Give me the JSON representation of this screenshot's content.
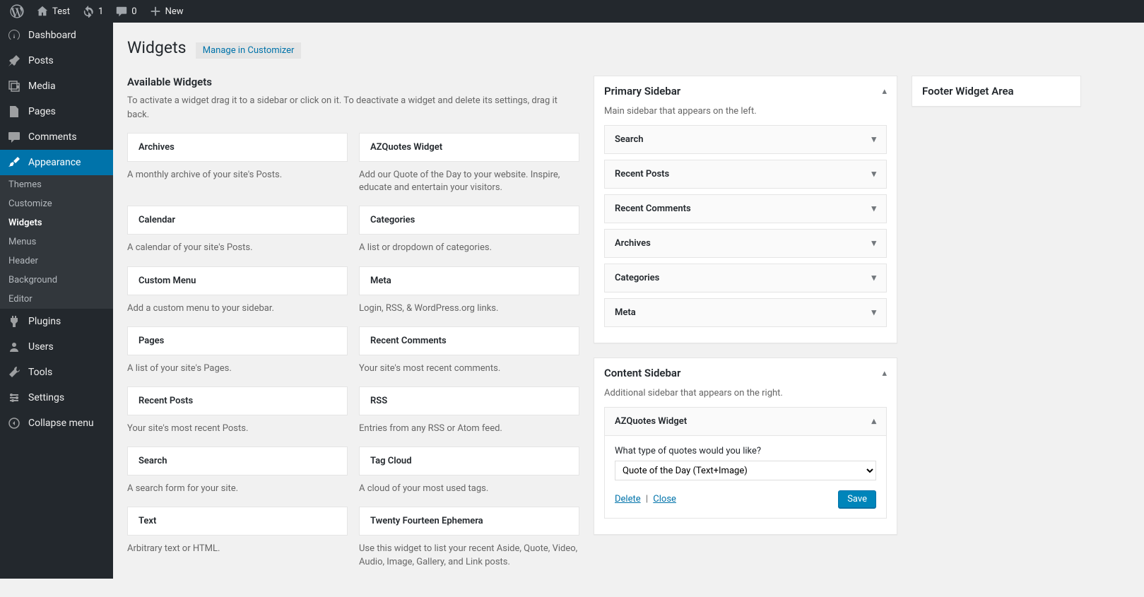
{
  "adminbar": {
    "site": "Test",
    "updates": "1",
    "comments": "0",
    "new": "New"
  },
  "menu": {
    "dashboard": "Dashboard",
    "posts": "Posts",
    "media": "Media",
    "pages": "Pages",
    "comments": "Comments",
    "appearance": "Appearance",
    "appearance_sub": {
      "themes": "Themes",
      "customize": "Customize",
      "widgets": "Widgets",
      "menus": "Menus",
      "header": "Header",
      "background": "Background",
      "editor": "Editor"
    },
    "plugins": "Plugins",
    "users": "Users",
    "tools": "Tools",
    "settings": "Settings",
    "collapse": "Collapse menu"
  },
  "page": {
    "title": "Widgets",
    "action": "Manage in Customizer"
  },
  "available": {
    "heading": "Available Widgets",
    "desc": "To activate a widget drag it to a sidebar or click on it. To deactivate a widget and delete its settings, drag it back.",
    "items": [
      {
        "t": "Archives",
        "d": "A monthly archive of your site's Posts."
      },
      {
        "t": "AZQuotes Widget",
        "d": "Add our Quote of the Day to your website. Inspire, educate and entertain your visitors."
      },
      {
        "t": "Calendar",
        "d": "A calendar of your site's Posts."
      },
      {
        "t": "Categories",
        "d": "A list or dropdown of categories."
      },
      {
        "t": "Custom Menu",
        "d": "Add a custom menu to your sidebar."
      },
      {
        "t": "Meta",
        "d": "Login, RSS, & WordPress.org links."
      },
      {
        "t": "Pages",
        "d": "A list of your site's Pages."
      },
      {
        "t": "Recent Comments",
        "d": "Your site's most recent comments."
      },
      {
        "t": "Recent Posts",
        "d": "Your site's most recent Posts."
      },
      {
        "t": "RSS",
        "d": "Entries from any RSS or Atom feed."
      },
      {
        "t": "Search",
        "d": "A search form for your site."
      },
      {
        "t": "Tag Cloud",
        "d": "A cloud of your most used tags."
      },
      {
        "t": "Text",
        "d": "Arbitrary text or HTML."
      },
      {
        "t": "Twenty Fourteen Ephemera",
        "d": "Use this widget to list your recent Aside, Quote, Video, Audio, Image, Gallery, and Link posts."
      }
    ]
  },
  "primary_sidebar": {
    "title": "Primary Sidebar",
    "desc": "Main sidebar that appears on the left.",
    "widgets": [
      "Search",
      "Recent Posts",
      "Recent Comments",
      "Archives",
      "Categories",
      "Meta"
    ]
  },
  "content_sidebar": {
    "title": "Content Sidebar",
    "desc": "Additional sidebar that appears on the right.",
    "open_widget": {
      "title": "AZQuotes Widget",
      "label": "What type of quotes would you like?",
      "selected": "Quote of the Day (Text+Image)",
      "delete": "Delete",
      "close": "Close",
      "save": "Save"
    }
  },
  "footer_area": {
    "title": "Footer Widget Area"
  }
}
